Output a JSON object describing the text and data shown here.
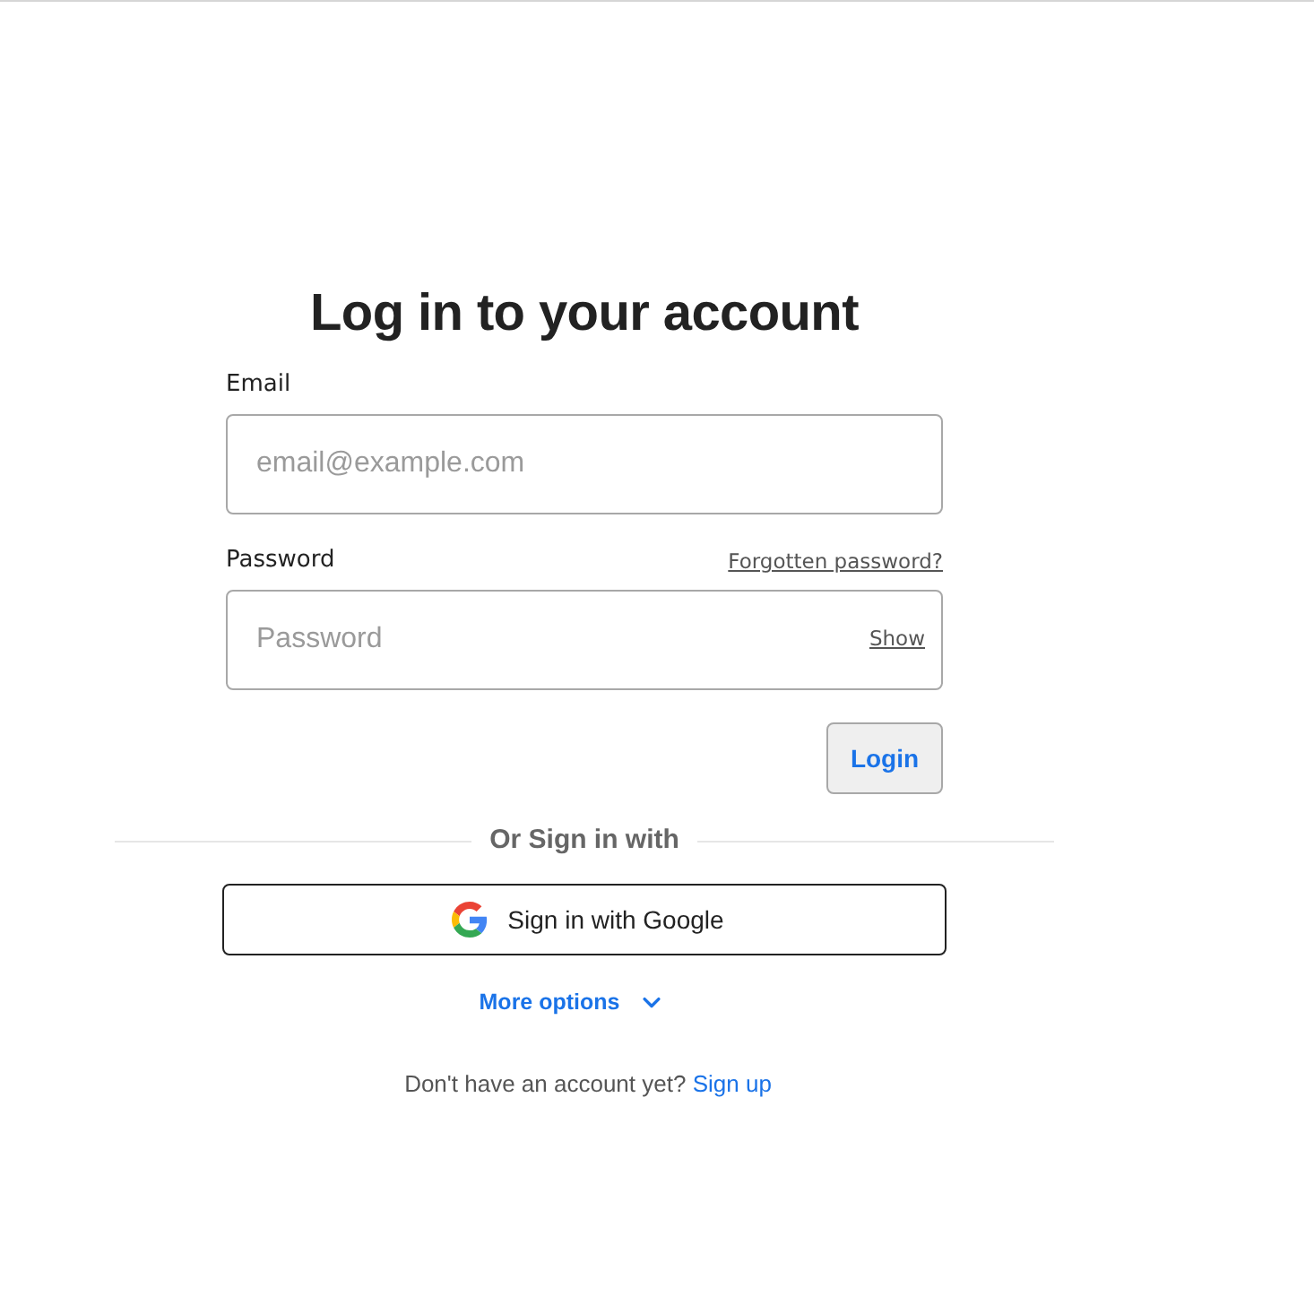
{
  "title": "Log in to your account",
  "email": {
    "label": "Email",
    "placeholder": "email@example.com"
  },
  "password": {
    "label": "Password",
    "forgot_link": "Forgotten password?",
    "placeholder": "Password",
    "show_toggle": "Show"
  },
  "login_button": "Login",
  "divider": "Or Sign in with",
  "google_button": "Sign in with Google",
  "more_options": {
    "label": "More options",
    "expanded": false
  },
  "signup": {
    "prompt": "Don't have an account yet?",
    "link": "Sign up"
  }
}
